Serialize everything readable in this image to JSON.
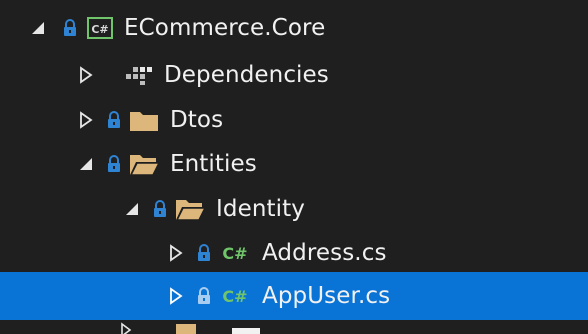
{
  "solution_explorer": {
    "items": [
      {
        "label": "ECommerce.Core",
        "expanded": true,
        "icon": "csharp-project-icon",
        "locked": true
      },
      {
        "label": "Dependencies",
        "expanded": false,
        "icon": "dependencies-icon",
        "locked": false
      },
      {
        "label": "Dtos",
        "expanded": false,
        "icon": "folder-icon",
        "locked": true
      },
      {
        "label": "Entities",
        "expanded": true,
        "icon": "folder-open-icon",
        "locked": true
      },
      {
        "label": "Identity",
        "expanded": true,
        "icon": "folder-open-icon",
        "locked": true
      },
      {
        "label": "Address.cs",
        "expanded": false,
        "icon": "csharp-file-icon",
        "locked": true
      },
      {
        "label": "AppUser.cs",
        "expanded": false,
        "icon": "csharp-file-icon",
        "locked": true,
        "selected": true
      }
    ],
    "csharp_badge": "C#"
  },
  "colors": {
    "background": "#1f1f1f",
    "text": "#f1f1f1",
    "selection": "#0a74d6",
    "lock": "#2f83d3",
    "folder": "#dcb67a",
    "csharp_green": "#70c46a"
  }
}
